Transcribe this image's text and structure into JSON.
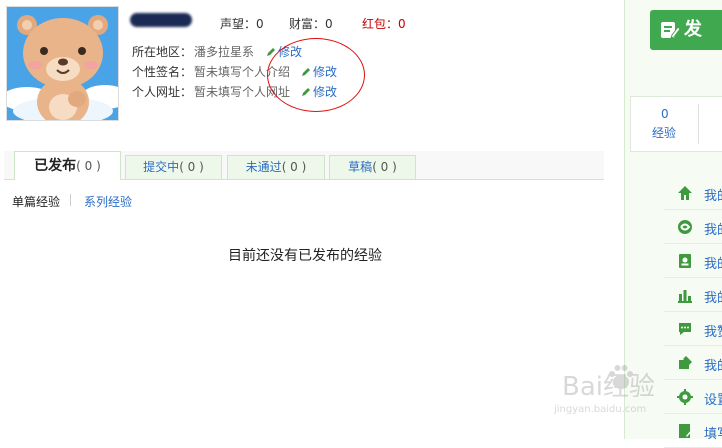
{
  "profile": {
    "stats": {
      "prestige": "声望：0",
      "wealth": "财富：0",
      "redpacket": "红包：0"
    },
    "region": {
      "label": "所在地区：",
      "value": "潘多拉星系"
    },
    "signature": {
      "label": "个性签名：",
      "value": "暂未填写个人介绍"
    },
    "website": {
      "label": "个人网址：",
      "value": "暂未填写个人网址"
    },
    "edit_label": "修改"
  },
  "tabs": [
    {
      "label": "已发布",
      "count": "( 0 )"
    },
    {
      "label": "提交中",
      "count": "( 0 )"
    },
    {
      "label": "未通过",
      "count": "( 0 )"
    },
    {
      "label": "草稿",
      "count": "( 0 )"
    }
  ],
  "subtabs": {
    "single": "单篇经验",
    "series": "系列经验"
  },
  "empty_message": "目前还没有已发布的经验",
  "sidebar": {
    "post_button_label": "发",
    "stats": {
      "count": "0",
      "label": "经验"
    },
    "menu": [
      {
        "label": "我的",
        "icon": "home-icon"
      },
      {
        "label": "我的",
        "icon": "swirl-icon"
      },
      {
        "label": "我的",
        "icon": "contact-icon"
      },
      {
        "label": "我的",
        "icon": "bar-chart-icon"
      },
      {
        "label": "我赞",
        "icon": "chat-bubble-icon"
      },
      {
        "label": "我的",
        "icon": "reward-icon"
      },
      {
        "label": "设置",
        "icon": "gear-icon"
      },
      {
        "label": "填写",
        "icon": "edit-form-icon"
      }
    ]
  },
  "watermark": {
    "brand": "Bai经验",
    "url": "jingyan.baidu.com"
  },
  "colors": {
    "accent_green": "#40a84f",
    "link_blue": "#2b6cc4",
    "alert_red": "#c40000"
  }
}
